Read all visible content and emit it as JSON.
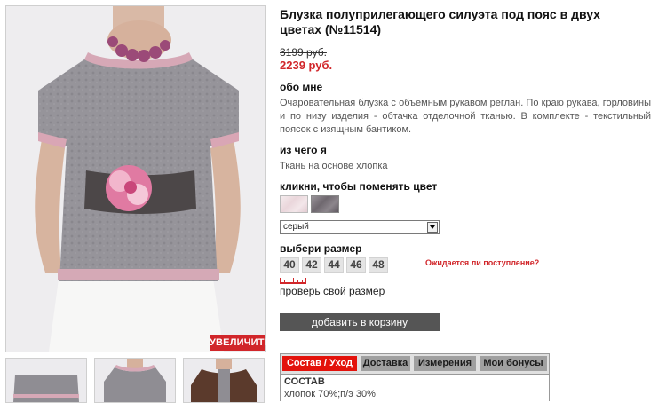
{
  "product": {
    "title": "Блузка полуприлегающего силуэта под пояс в двух цветах (№11514)",
    "old_price": "3199 руб.",
    "new_price": "2239 руб."
  },
  "gallery": {
    "zoom_label": "УВЕЛИЧИТЬ"
  },
  "about": {
    "heading": "обо мне",
    "text": "Очаровательная блузка с объемным рукавом реглан. По краю рукава, горловины и по низу изделия - обтачка отделочной тканью. В комплекте - текстильный поясок с изящным бантиком."
  },
  "material": {
    "heading": "из чего я",
    "text": "Ткань на основе хлопка"
  },
  "color": {
    "heading": "кликни, чтобы поменять цвет",
    "selected": "серый"
  },
  "size": {
    "heading": "выбери размер",
    "options": [
      "40",
      "42",
      "44",
      "46",
      "48"
    ],
    "awaiting_link": "Ожидается ли поступление?",
    "check_link": "проверь свой размер"
  },
  "cart": {
    "button_label": "добавить в корзину"
  },
  "tabs": {
    "items": [
      "Состав / Уход",
      "Доставка",
      "Измерения",
      "Мои бонусы"
    ],
    "active_index": 0,
    "content_heading": "СОСТАВ",
    "content_text": "хлопок 70%;п/э 30%"
  },
  "colors": {
    "accent_red": "#d1262a",
    "button_grey": "#555555"
  }
}
